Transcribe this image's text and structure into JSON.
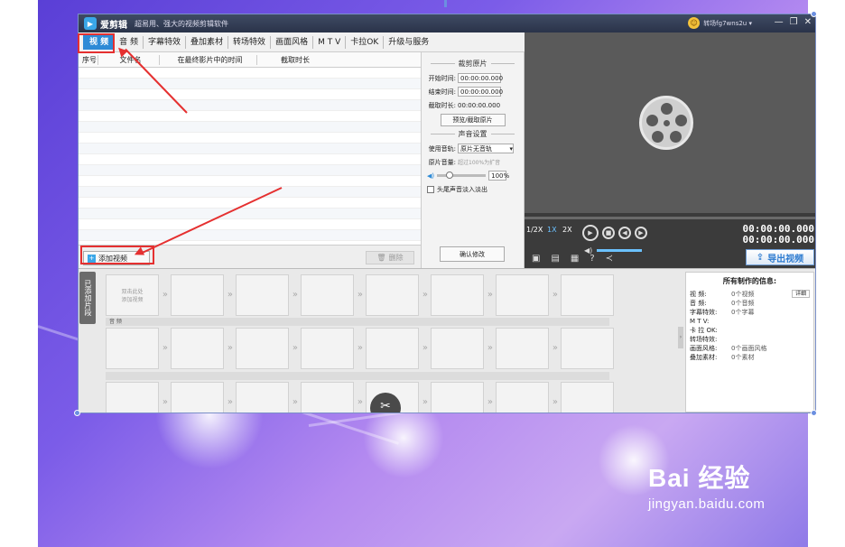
{
  "titlebar": {
    "app_name": "爱剪辑",
    "slogan": "超易用、强大的视频剪辑软件",
    "username": "转场fg7wns2u ▾",
    "min": "—",
    "restore": "❐",
    "close": "✕"
  },
  "tabs": [
    "视 频",
    "音 频",
    "字幕特效",
    "叠加素材",
    "转场特效",
    "画面风格",
    "M T V",
    "卡拉OK",
    "升级与服务"
  ],
  "list": {
    "headers": [
      "序号",
      "文件名",
      "在最终影片中的时间",
      "截取时长"
    ],
    "add_label": "添加视频",
    "delete_label": "删除"
  },
  "cropper": {
    "title": "裁剪原片",
    "start_label": "开始时间:",
    "start_value": "00:00:00.000",
    "end_label": "结束时间:",
    "end_value": "00:00:00.000",
    "duration_label": "截取时长:",
    "duration_value": "00:00:00.000",
    "preview_btn": "预览/截取原片",
    "audio_title": "声音设置",
    "track_label": "使用音轨:",
    "track_value": "原片无音轨",
    "volume_label": "原片音量:",
    "volume_hint": "超过100%为扩音",
    "volume_value": "100%",
    "volume_level": 0.25,
    "fade_label": "头尾声音淡入淡出",
    "confirm_btn": "确认修改"
  },
  "player": {
    "speeds": [
      "1/2X",
      "1X",
      "2X"
    ],
    "time1": "00:00:00.000",
    "time2": "00:00:00.000",
    "export_label": "导出视频"
  },
  "timeline": {
    "side_tab": "已添加片段",
    "first_cell": "双击此处\n添加视频",
    "audio_label": "音 频"
  },
  "info": {
    "title": "所有制作的信息:",
    "rows": [
      {
        "k": "视    频:",
        "v": "0个视频"
      },
      {
        "k": "音    频:",
        "v": "0个音频"
      },
      {
        "k": "字幕特效:",
        "v": "0个字幕"
      },
      {
        "k": "M  T  V:",
        "v": ""
      },
      {
        "k": "卡 拉 OK:",
        "v": ""
      },
      {
        "k": "转场特效:",
        "v": ""
      },
      {
        "k": "画面风格:",
        "v": "0个画面风格"
      },
      {
        "k": "叠加素材:",
        "v": "0个素材"
      }
    ],
    "detail_btn": "详细"
  },
  "watermark": {
    "logo": "Bai 经验",
    "url": "jingyan.baidu.com"
  }
}
